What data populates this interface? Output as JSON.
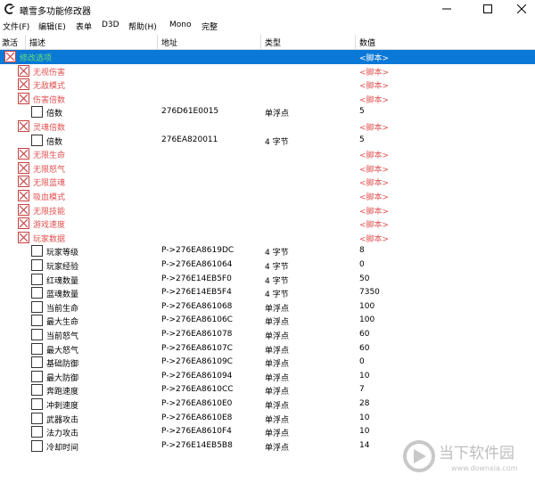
{
  "window": {
    "title": "曦雪多功能修改器"
  },
  "menu": [
    "文件(F)",
    "编辑(E)",
    "表单",
    "D3D",
    "帮助(H)",
    "Mono",
    "完整"
  ],
  "columns": {
    "active": "激活",
    "desc": "描述",
    "addr": "地址",
    "type": "类型",
    "value": "数值"
  },
  "rows": [
    {
      "indent": 0,
      "checkbox": "x",
      "desc": "修改选项",
      "addr": "",
      "type": "",
      "value": "<脚本>",
      "red": false,
      "selected": true
    },
    {
      "indent": 1,
      "checkbox": "x",
      "desc": "无视伤害",
      "addr": "",
      "type": "",
      "value": "<脚本>",
      "red": true
    },
    {
      "indent": 1,
      "checkbox": "x",
      "desc": "无敌模式",
      "addr": "",
      "type": "",
      "value": "<脚本>",
      "red": true
    },
    {
      "indent": 1,
      "checkbox": "x",
      "desc": "伤害倍数",
      "addr": "",
      "type": "",
      "value": "<脚本>",
      "red": true
    },
    {
      "indent": 2,
      "checkbox": "empty",
      "desc": "倍数",
      "addr": "276D61E0015",
      "type": "单浮点",
      "value": "5",
      "red": false
    },
    {
      "indent": 1,
      "checkbox": "x",
      "desc": "灵魂倍数",
      "addr": "",
      "type": "",
      "value": "<脚本>",
      "red": true
    },
    {
      "indent": 2,
      "checkbox": "empty",
      "desc": "倍数",
      "addr": "276EA820011",
      "type": "4 字节",
      "value": "5",
      "red": false
    },
    {
      "indent": 1,
      "checkbox": "x",
      "desc": "无限生命",
      "addr": "",
      "type": "",
      "value": "<脚本>",
      "red": true
    },
    {
      "indent": 1,
      "checkbox": "x",
      "desc": "无限怒气",
      "addr": "",
      "type": "",
      "value": "<脚本>",
      "red": true
    },
    {
      "indent": 1,
      "checkbox": "x",
      "desc": "无限蓝魂",
      "addr": "",
      "type": "",
      "value": "<脚本>",
      "red": true
    },
    {
      "indent": 1,
      "checkbox": "x",
      "desc": "吸血模式",
      "addr": "",
      "type": "",
      "value": "<脚本>",
      "red": true
    },
    {
      "indent": 1,
      "checkbox": "x",
      "desc": "无限技能",
      "addr": "",
      "type": "",
      "value": "<脚本>",
      "red": true
    },
    {
      "indent": 1,
      "checkbox": "x",
      "desc": "游戏速度",
      "addr": "",
      "type": "",
      "value": "<脚本>",
      "red": true
    },
    {
      "indent": 1,
      "checkbox": "x",
      "desc": "玩家数据",
      "addr": "",
      "type": "",
      "value": "<脚本>",
      "red": true
    },
    {
      "indent": 2,
      "checkbox": "empty",
      "desc": "玩家等级",
      "addr": "P->276EA8619DC",
      "type": "4 字节",
      "value": "8",
      "red": false
    },
    {
      "indent": 2,
      "checkbox": "empty",
      "desc": "玩家经验",
      "addr": "P->276EA861064",
      "type": "4 字节",
      "value": "0",
      "red": false
    },
    {
      "indent": 2,
      "checkbox": "empty",
      "desc": "红魂数量",
      "addr": "P->276E14EB5F0",
      "type": "4 字节",
      "value": "50",
      "red": false
    },
    {
      "indent": 2,
      "checkbox": "empty",
      "desc": "蓝魂数量",
      "addr": "P->276E14EB5F4",
      "type": "4 字节",
      "value": "7350",
      "red": false
    },
    {
      "indent": 2,
      "checkbox": "empty",
      "desc": "当前生命",
      "addr": "P->276EA861068",
      "type": "单浮点",
      "value": "100",
      "red": false
    },
    {
      "indent": 2,
      "checkbox": "empty",
      "desc": "最大生命",
      "addr": "P->276EA86106C",
      "type": "单浮点",
      "value": "100",
      "red": false
    },
    {
      "indent": 2,
      "checkbox": "empty",
      "desc": "当前怒气",
      "addr": "P->276EA861078",
      "type": "单浮点",
      "value": "60",
      "red": false
    },
    {
      "indent": 2,
      "checkbox": "empty",
      "desc": "最大怒气",
      "addr": "P->276EA86107C",
      "type": "单浮点",
      "value": "60",
      "red": false
    },
    {
      "indent": 2,
      "checkbox": "empty",
      "desc": "基础防御",
      "addr": "P->276EA86109C",
      "type": "单浮点",
      "value": "0",
      "red": false
    },
    {
      "indent": 2,
      "checkbox": "empty",
      "desc": "最大防御",
      "addr": "P->276EA861094",
      "type": "单浮点",
      "value": "10",
      "red": false
    },
    {
      "indent": 2,
      "checkbox": "empty",
      "desc": "奔跑速度",
      "addr": "P->276EA8610CC",
      "type": "单浮点",
      "value": "7",
      "red": false
    },
    {
      "indent": 2,
      "checkbox": "empty",
      "desc": "冲刺速度",
      "addr": "P->276EA8610E0",
      "type": "单浮点",
      "value": "28",
      "red": false
    },
    {
      "indent": 2,
      "checkbox": "empty",
      "desc": "武器攻击",
      "addr": "P->276EA8610E8",
      "type": "单浮点",
      "value": "10",
      "red": false
    },
    {
      "indent": 2,
      "checkbox": "empty",
      "desc": "法力攻击",
      "addr": "P->276EA8610F4",
      "type": "单浮点",
      "value": "10",
      "red": false
    },
    {
      "indent": 2,
      "checkbox": "empty",
      "desc": "冷却时间",
      "addr": "P->276E14EB5B8",
      "type": "单浮点",
      "value": "14",
      "red": false
    }
  ],
  "watermark": {
    "cn": "当下软件园",
    "url": "www.downxia.com"
  },
  "colors": {
    "selection": "#0a78d7",
    "script_red": "#e05050",
    "selected_name": "#66e070"
  }
}
